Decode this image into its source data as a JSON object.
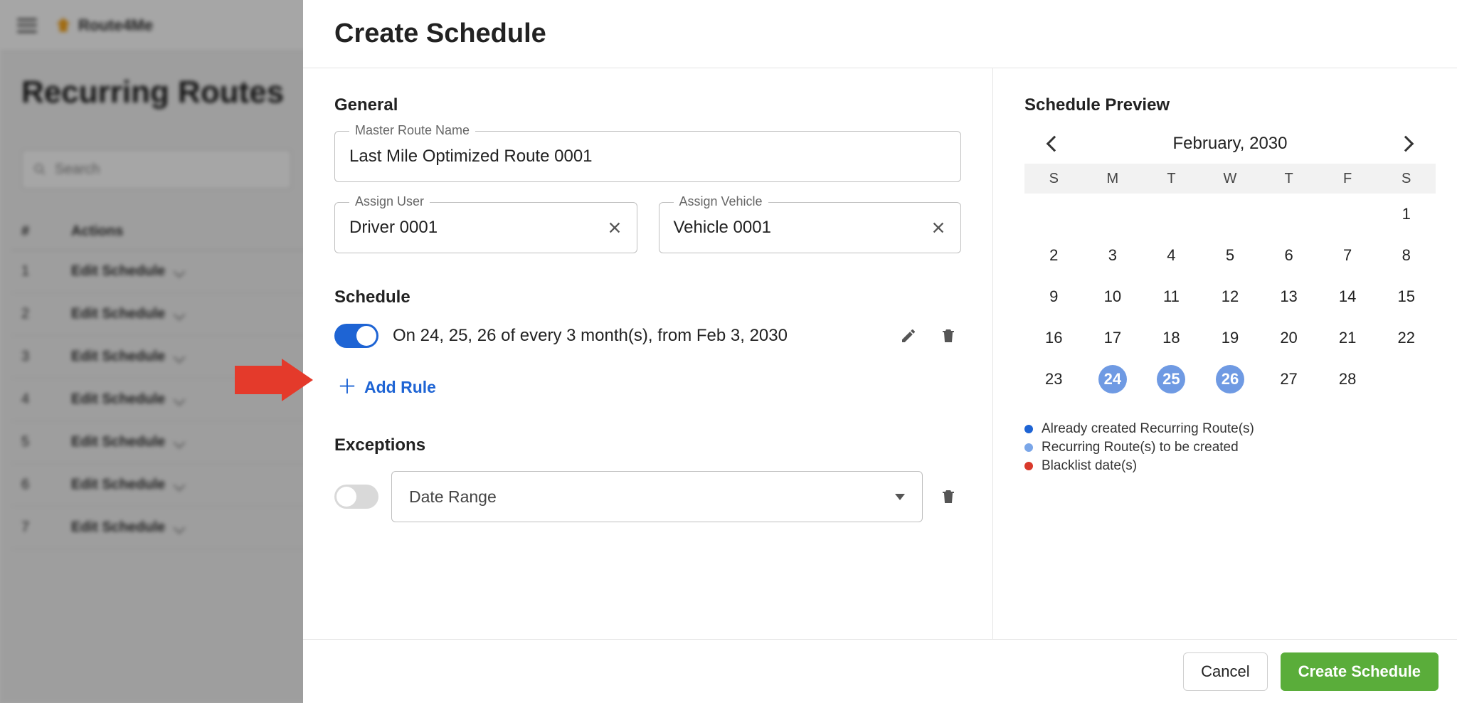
{
  "bg": {
    "logo_text": "Route4Me",
    "page_title": "Recurring Routes",
    "search_placeholder": "Search",
    "th_num": "#",
    "th_actions": "Actions",
    "rows": [
      {
        "n": "1",
        "label": "Edit Schedule"
      },
      {
        "n": "2",
        "label": "Edit Schedule"
      },
      {
        "n": "3",
        "label": "Edit Schedule"
      },
      {
        "n": "4",
        "label": "Edit Schedule"
      },
      {
        "n": "5",
        "label": "Edit Schedule"
      },
      {
        "n": "6",
        "label": "Edit Schedule"
      },
      {
        "n": "7",
        "label": "Edit Schedule"
      }
    ]
  },
  "modal": {
    "title": "Create Schedule",
    "general": {
      "heading": "General",
      "route_name_label": "Master Route Name",
      "route_name_value": "Last Mile Optimized Route 0001",
      "assign_user_label": "Assign User",
      "assign_user_value": "Driver 0001",
      "assign_vehicle_label": "Assign Vehicle",
      "assign_vehicle_value": "Vehicle 0001"
    },
    "schedule": {
      "heading": "Schedule",
      "rule_text": "On 24, 25, 26 of every 3 month(s), from Feb 3, 2030",
      "add_rule_label": "Add Rule"
    },
    "exceptions": {
      "heading": "Exceptions",
      "select_label": "Date Range"
    },
    "footer": {
      "cancel": "Cancel",
      "create": "Create Schedule"
    }
  },
  "preview": {
    "heading": "Schedule Preview",
    "month_label": "February, 2030",
    "dow": [
      "S",
      "M",
      "T",
      "W",
      "T",
      "F",
      "S"
    ],
    "cells": [
      "",
      "",
      "",
      "",
      "",
      "",
      "1",
      "2",
      "3",
      "4",
      "5",
      "6",
      "7",
      "8",
      "9",
      "10",
      "11",
      "12",
      "13",
      "14",
      "15",
      "16",
      "17",
      "18",
      "19",
      "20",
      "21",
      "22",
      "23",
      "24",
      "25",
      "26",
      "27",
      "28",
      ""
    ],
    "selected": [
      "24",
      "25",
      "26"
    ],
    "legend": {
      "created": "Already created Recurring Route(s)",
      "tobe": "Recurring Route(s) to be created",
      "blacklist": "Blacklist date(s)"
    }
  }
}
